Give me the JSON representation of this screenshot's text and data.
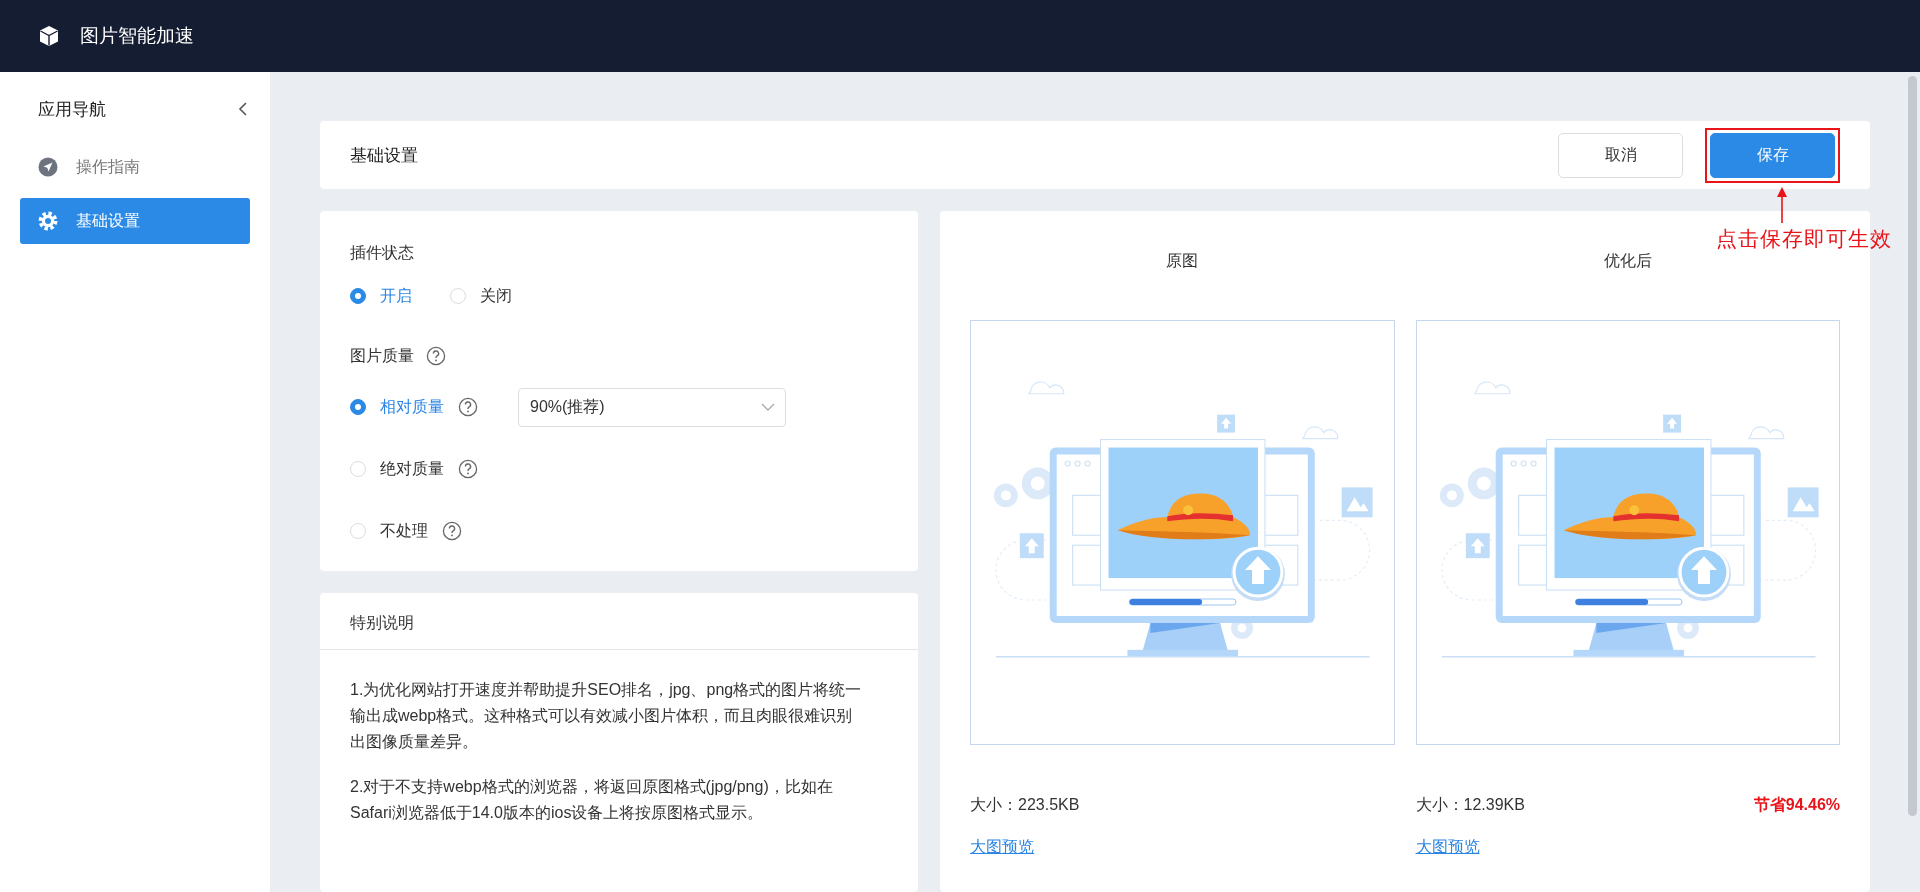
{
  "app": {
    "title": "图片智能加速"
  },
  "sidebar": {
    "title": "应用导航",
    "items": [
      {
        "label": "操作指南",
        "kind": "guide",
        "selected": false
      },
      {
        "label": "基础设置",
        "kind": "settings",
        "selected": true
      }
    ]
  },
  "toolbar": {
    "title": "基础设置",
    "buttons": [
      {
        "label": "取消",
        "kind": "default",
        "highlighted": false
      },
      {
        "label": "保存",
        "kind": "primary",
        "highlighted": true
      }
    ]
  },
  "annotation": {
    "text": "点击保存即可生效"
  },
  "settings": {
    "groups": [
      {
        "label": "插件状态",
        "kind": "inline",
        "options": [
          {
            "label": "开启",
            "selected": true
          },
          {
            "label": "关闭",
            "selected": false
          }
        ]
      },
      {
        "label": "图片质量",
        "help": true,
        "kind": "stacked",
        "options": [
          {
            "label": "相对质量",
            "selected": true,
            "help": true,
            "select": {
              "value": "90%(推荐)"
            }
          },
          {
            "label": "绝对质量",
            "selected": false,
            "help": true
          },
          {
            "label": "不处理",
            "selected": false,
            "help": true
          }
        ]
      }
    ]
  },
  "notes": {
    "title": "特别说明",
    "paragraphs": [
      "1.为优化网站打开速度并帮助提升SEO排名，jpg、png格式的图片将统一输出成webp格式。这种格式可以有效减小图片体积，而且肉眼很难识别出图像质量差异。",
      "2.对于不支持webp格式的浏览器，将返回原图格式(jpg/png)，比如在Safari浏览器低于14.0版本的ios设备上将按原图格式显示。"
    ]
  },
  "comparison": {
    "images": [
      {
        "title": "原图",
        "size": "大小：223.5KB",
        "link": "大图预览"
      },
      {
        "title": "优化后",
        "size": "大小：12.39KB",
        "saving": "节省94.46%",
        "link": "大图预览"
      }
    ]
  }
}
